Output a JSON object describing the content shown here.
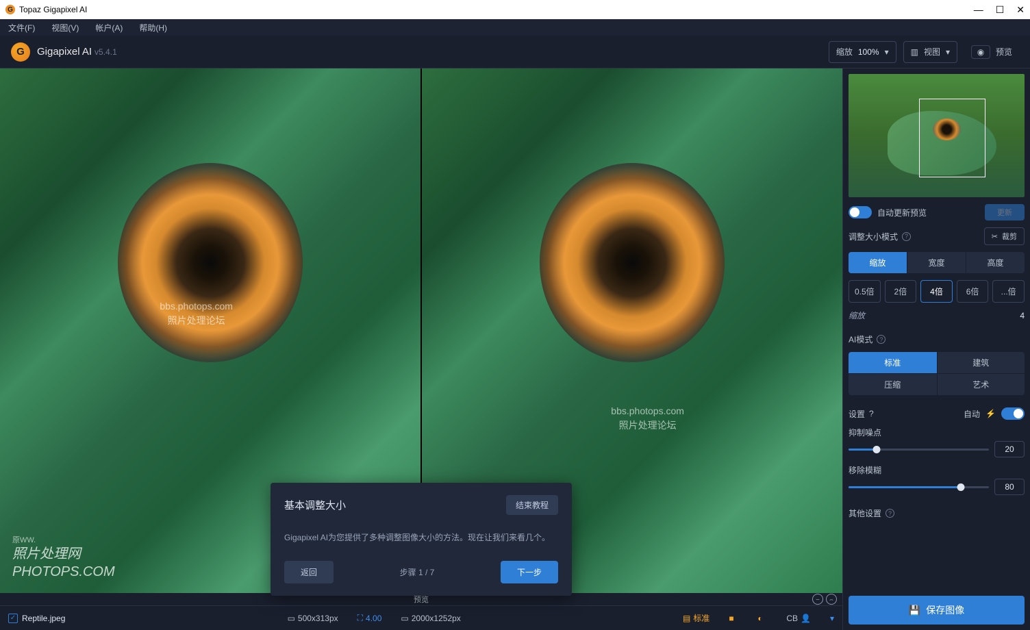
{
  "window": {
    "title": "Topaz Gigapixel AI"
  },
  "menubar": {
    "file": "文件(F)",
    "view": "视图(V)",
    "account": "帐户(A)",
    "help": "帮助(H)"
  },
  "toolbar": {
    "app_name": "Gigapixel AI",
    "version": "v5.4.1",
    "zoom_label": "缩放",
    "zoom_value": "100%",
    "view_label": "视图",
    "preview_label": "预览"
  },
  "watermark": {
    "line1": "bbs.photops.com",
    "line2": "照片处理论坛"
  },
  "corner_wm": {
    "line1": "照片处理网",
    "line2": "PHOTOPS.COM",
    "pre": "原WW."
  },
  "footer": {
    "preview": "预览"
  },
  "status": {
    "filename": "Reptile.jpeg",
    "orig_dims": "500x313px",
    "scale_value": "4.00",
    "out_dims": "2000x1252px",
    "mode": "标准",
    "cb": "CB"
  },
  "tutorial": {
    "title": "基本调整大小",
    "end_label": "结束教程",
    "desc": "Gigapixel AI为您提供了多种调整图像大小的方法。现在让我们来看几个。",
    "back_label": "返回",
    "step_label": "步骤 1 / 7",
    "next_label": "下一步"
  },
  "sidebar": {
    "auto_update_label": "自动更新预览",
    "refresh_label": "更新",
    "resize_mode_label": "调整大小模式",
    "crop_label": "裁剪",
    "resize_tabs": {
      "scale": "缩放",
      "width": "宽度",
      "height": "高度"
    },
    "scale_options": {
      "x05": "0.5倍",
      "x2": "2倍",
      "x4": "4倍",
      "x6": "6倍",
      "custom": "...倍"
    },
    "scale_label": "缩放",
    "scale_value": "4",
    "ai_mode_label": "AI模式",
    "ai_tabs": {
      "standard": "标准",
      "arch": "建筑",
      "compress": "压缩",
      "art": "艺术"
    },
    "settings_label": "设置",
    "auto_label": "自动",
    "noise_label": "抑制噪点",
    "noise_value": "20",
    "blur_label": "移除模糊",
    "blur_value": "80",
    "other_label": "其他设置",
    "save_label": "保存图像"
  }
}
